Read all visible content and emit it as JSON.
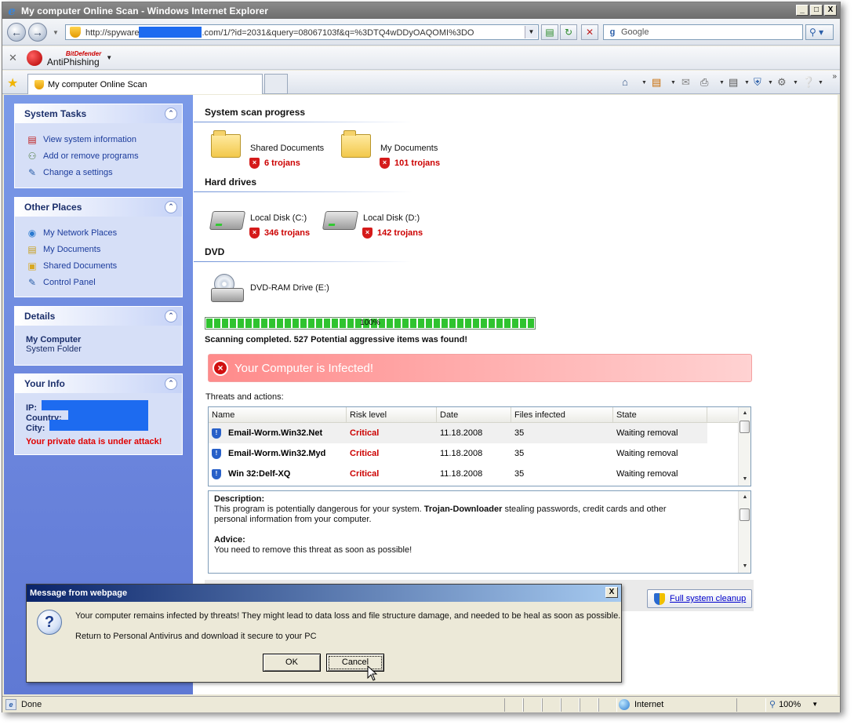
{
  "window": {
    "title": "My computer Online Scan - Windows Internet Explorer",
    "controls": [
      "_",
      "□",
      "X"
    ]
  },
  "address_bar": {
    "url_prefix": "http://spyware",
    "url_suffix": ".com/1/?id=2031&query=08067103f&q=%3DTQ4wDDyOAQOMI%3DO",
    "search_placeholder": "Google"
  },
  "toolbar": {
    "bitdefender_brand": "BitDefender",
    "bitdefender_product": "AntiPhishing"
  },
  "tab": {
    "label": "My computer Online Scan"
  },
  "sidebar": {
    "system_tasks": {
      "title": "System Tasks",
      "items": [
        {
          "label": "View system information",
          "icon": "system-info-icon"
        },
        {
          "label": "Add or remove programs",
          "icon": "add-remove-icon"
        },
        {
          "label": "Change a settings",
          "icon": "settings-icon"
        }
      ]
    },
    "other_places": {
      "title": "Other Places",
      "items": [
        {
          "label": "My Network Places",
          "icon": "network-icon"
        },
        {
          "label": "My Documents",
          "icon": "documents-icon"
        },
        {
          "label": "Shared Documents",
          "icon": "shared-folder-icon"
        },
        {
          "label": "Control Panel",
          "icon": "control-panel-icon"
        }
      ]
    },
    "details": {
      "title": "Details",
      "name": "My Computer",
      "type": "System Folder"
    },
    "your_info": {
      "title": "Your Info",
      "ip_label": "IP:",
      "country_label": "Country:",
      "city_label": "City:",
      "warning": "Your private data is under attack!"
    }
  },
  "scan": {
    "progress_title": "System scan progress",
    "folders": [
      {
        "label": "Shared Documents",
        "result": "6 trojans"
      },
      {
        "label": "My Documents",
        "result": "101 trojans"
      }
    ],
    "hard_drives_title": "Hard drives",
    "drives": [
      {
        "label": "Local Disk (C:)",
        "result": "346 trojans"
      },
      {
        "label": "Local Disk (D:)",
        "result": "142 trojans"
      }
    ],
    "dvd_title": "DVD",
    "dvd": {
      "label": "DVD-RAM Drive (E:)"
    },
    "progress_percent": 100,
    "progress_text": "100%",
    "completed_text": "Scanning completed. 527 Potential aggressive items was found!",
    "infected_banner": "Your Computer is Infected!",
    "threats_label": "Threats and actions:"
  },
  "threats_table": {
    "columns": [
      "Name",
      "Risk level",
      "Date",
      "Files infected",
      "State"
    ],
    "rows": [
      {
        "name": "Email-Worm.Win32.Net",
        "risk": "Critical",
        "date": "11.18.2008",
        "files": "35",
        "state": "Waiting removal"
      },
      {
        "name": "Email-Worm.Win32.Myd",
        "risk": "Critical",
        "date": "11.18.2008",
        "files": "35",
        "state": "Waiting removal"
      },
      {
        "name": "Win 32:Delf-XQ",
        "risk": "Critical",
        "date": "11.18.2008",
        "files": "35",
        "state": "Waiting removal"
      }
    ]
  },
  "description": {
    "desc_label": "Description:",
    "desc_text_1": "This program is potentially dangerous for your system. ",
    "desc_bold": "Trojan-Downloader",
    "desc_text_2": " stealing passwords, credit cards and other",
    "desc_text_3": "personal information from your computer.",
    "advice_label": "Advice:",
    "advice_text": "You need to remove this threat as soon as possible!"
  },
  "cleanup_button": {
    "label": "Full system cleanup"
  },
  "dialog": {
    "title": "Message from webpage",
    "close": "X",
    "message_1": "Your computer remains infected by threats! They might lead to data loss and file structure damage, and needed to be heal as soon as possible.",
    "message_2": "Return to Personal Antivirus and download it secure to your PC",
    "ok_label": "OK",
    "cancel_label": "Cancel"
  },
  "statusbar": {
    "status": "Done",
    "zone": "Internet",
    "zoom": "100%"
  },
  "colors": {
    "sidebar_bg": "#6a84dc",
    "trojan_red": "#cc0000",
    "banner_red": "#ff8a8a",
    "progress_green": "#2fc32f"
  }
}
